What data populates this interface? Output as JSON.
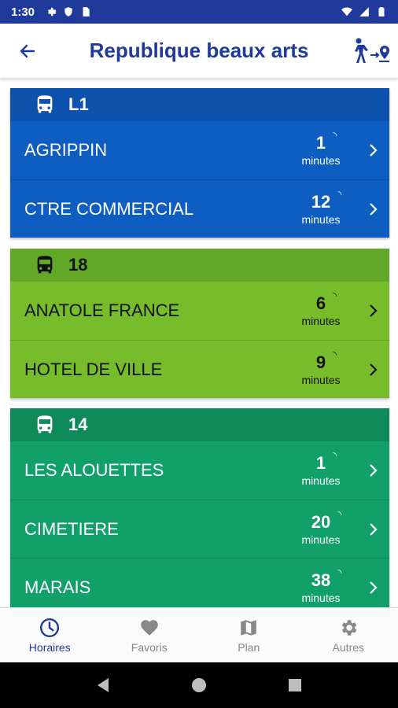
{
  "status_bar": {
    "time": "1:30"
  },
  "appbar": {
    "title": "Republique beaux arts"
  },
  "lines": [
    {
      "name": "L1",
      "color_header": "#0d52ad",
      "color_body": "#0d5ec0",
      "text_color": "#ffffff",
      "departures": [
        {
          "destination": "AGRIPPIN",
          "minutes": "1",
          "unit": "minutes"
        },
        {
          "destination": "CTRE COMMERCIAL",
          "minutes": "12",
          "unit": "minutes"
        }
      ]
    },
    {
      "name": "18",
      "color_header": "#62a826",
      "color_body": "#76bc2b",
      "text_color": "#111111",
      "departures": [
        {
          "destination": "ANATOLE FRANCE",
          "minutes": "6",
          "unit": "minutes"
        },
        {
          "destination": "HOTEL DE VILLE",
          "minutes": "9",
          "unit": "minutes"
        }
      ]
    },
    {
      "name": "14",
      "color_header": "#0f8a5a",
      "color_body": "#12a06a",
      "text_color": "#ffffff",
      "departures": [
        {
          "destination": "LES ALOUETTES",
          "minutes": "1",
          "unit": "minutes"
        },
        {
          "destination": "CIMETIERE",
          "minutes": "20",
          "unit": "minutes"
        },
        {
          "destination": "MARAIS",
          "minutes": "38",
          "unit": "minutes"
        }
      ]
    }
  ],
  "bottom_nav": [
    {
      "label": "Horaires",
      "icon": "clock-icon",
      "active": true
    },
    {
      "label": "Favoris",
      "icon": "heart-icon",
      "active": false
    },
    {
      "label": "Plan",
      "icon": "map-icon",
      "active": false
    },
    {
      "label": "Autres",
      "icon": "gear-icon",
      "active": false
    }
  ],
  "colors": {
    "primary": "#1f3a9a",
    "inactive": "#888888"
  }
}
